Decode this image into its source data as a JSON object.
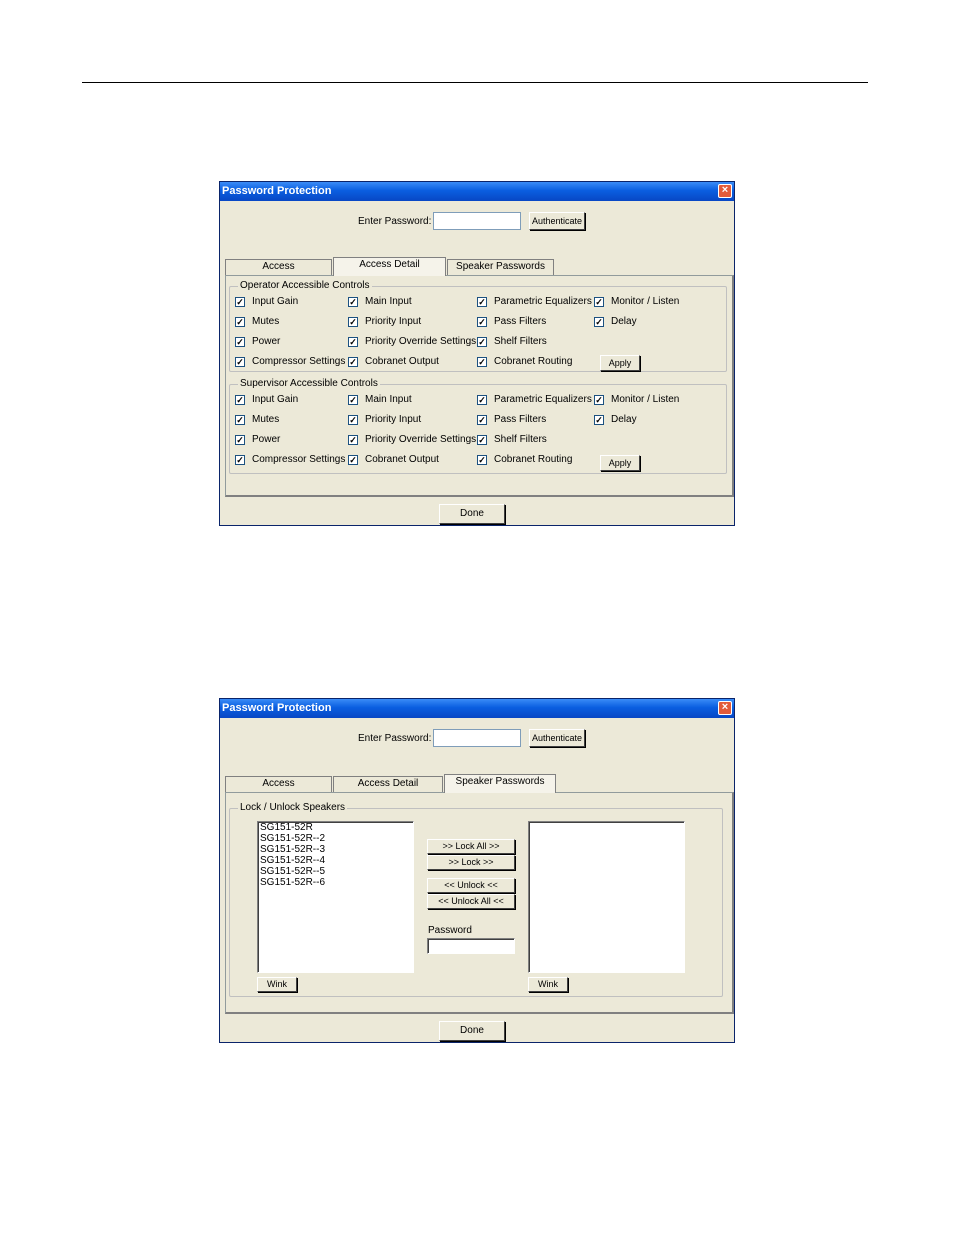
{
  "window_title": "Password Protection",
  "close_glyph": "×",
  "enter_password_label": "Enter Password:",
  "authenticate_label": "Authenticate",
  "tabs": [
    "Access",
    "Access Detail",
    "Speaker Passwords"
  ],
  "done_label": "Done",
  "check_glyph": "✓",
  "dialog1": {
    "active_tab": "Access Detail",
    "operator_group": {
      "legend": "Operator Accessible Controls",
      "items": [
        {
          "label": "Input Gain",
          "checked": true
        },
        {
          "label": "Main Input",
          "checked": true
        },
        {
          "label": "Parametric Equalizers",
          "checked": true
        },
        {
          "label": "Monitor / Listen",
          "checked": true
        },
        {
          "label": "Mutes",
          "checked": true
        },
        {
          "label": "Priority Input",
          "checked": true
        },
        {
          "label": "Pass Filters",
          "checked": true
        },
        {
          "label": "Delay",
          "checked": true
        },
        {
          "label": "Power",
          "checked": true
        },
        {
          "label": "Priority Override Settings",
          "checked": true
        },
        {
          "label": "Shelf Filters",
          "checked": true
        },
        {
          "label": "Compressor Settings",
          "checked": true
        },
        {
          "label": "Cobranet Output",
          "checked": true
        },
        {
          "label": "Cobranet Routing",
          "checked": true
        }
      ],
      "apply_label": "Apply"
    },
    "supervisor_group": {
      "legend": "Supervisor Accessible Controls",
      "items": [
        {
          "label": "Input Gain",
          "checked": true
        },
        {
          "label": "Main Input",
          "checked": true
        },
        {
          "label": "Parametric Equalizers",
          "checked": true
        },
        {
          "label": "Monitor / Listen",
          "checked": true
        },
        {
          "label": "Mutes",
          "checked": true
        },
        {
          "label": "Priority Input",
          "checked": true
        },
        {
          "label": "Pass Filters",
          "checked": true
        },
        {
          "label": "Delay",
          "checked": true
        },
        {
          "label": "Power",
          "checked": true
        },
        {
          "label": "Priority Override Settings",
          "checked": true
        },
        {
          "label": "Shelf Filters",
          "checked": true
        },
        {
          "label": "Compressor Settings",
          "checked": true
        },
        {
          "label": "Cobranet Output",
          "checked": true
        },
        {
          "label": "Cobranet Routing",
          "checked": true
        }
      ],
      "apply_label": "Apply"
    }
  },
  "dialog2": {
    "active_tab": "Speaker Passwords",
    "group_legend": "Lock / Unlock Speakers",
    "unlocked_speakers": [
      "SG151-52R",
      "SG151-52R--2",
      "SG151-52R--3",
      "SG151-52R--4",
      "SG151-52R--5",
      "SG151-52R--6"
    ],
    "locked_speakers": [],
    "lock_all_label": ">> Lock All >>",
    "lock_label": ">> Lock >>",
    "unlock_label": "<< Unlock <<",
    "unlock_all_label": "<< Unlock All <<",
    "password_label": "Password",
    "password_value": "",
    "wink_label": "Wink"
  }
}
